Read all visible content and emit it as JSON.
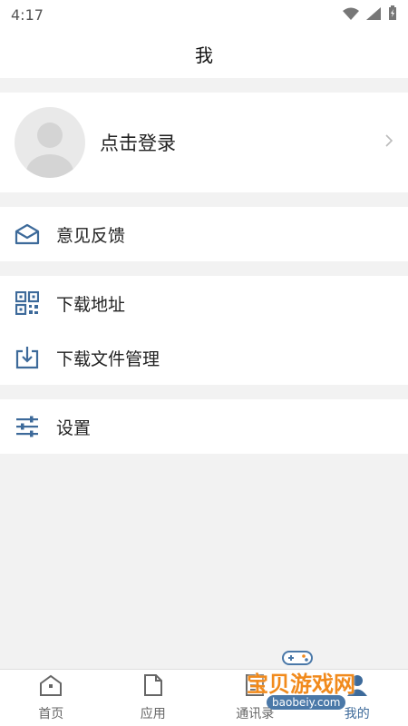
{
  "status": {
    "time": "4:17"
  },
  "header": {
    "title": "我"
  },
  "profile": {
    "login_label": "点击登录"
  },
  "menu": {
    "feedback": "意见反馈",
    "download_address": "下载地址",
    "download_manage": "下载文件管理",
    "settings": "设置"
  },
  "tabs": [
    {
      "label": "首页"
    },
    {
      "label": "应用"
    },
    {
      "label": "通讯录"
    },
    {
      "label": "我的"
    }
  ],
  "watermark": {
    "text": "宝贝游戏网",
    "url": "baobeiy.com"
  },
  "colors": {
    "icon_blue": "#3d6a9a",
    "accent_orange": "#f18a1c"
  }
}
